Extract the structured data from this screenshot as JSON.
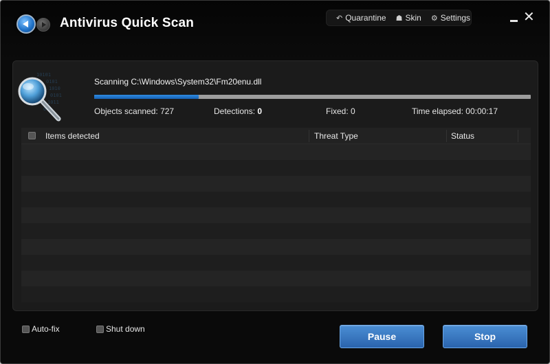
{
  "window": {
    "title": "Antivirus Quick Scan"
  },
  "toolbar": {
    "quarantine": {
      "label": "Quarantine",
      "icon": "undo-arrow-icon"
    },
    "skin": {
      "label": "Skin",
      "icon": "shirt-icon"
    },
    "settings": {
      "label": "Settings",
      "icon": "gear-icon"
    }
  },
  "scan": {
    "current_file": "Scanning C:\\Windows\\System32\\Fm20enu.dll",
    "progress_percent": 24,
    "objects_scanned_label": "Objects scanned:",
    "objects_scanned_value": "727",
    "detections_label": "Detections:",
    "detections_value": "0",
    "fixed_label": "Fixed:",
    "fixed_value": "0",
    "time_label": "Time elapsed:",
    "time_value": "00:00:17"
  },
  "table": {
    "columns": [
      "Items detected",
      "Threat Type",
      "Status"
    ],
    "rows": []
  },
  "footer": {
    "autofix_label": "Auto-fix",
    "shutdown_label": "Shut down",
    "pause_label": "Pause",
    "stop_label": "Stop"
  },
  "colors": {
    "accent": "#2f8be0",
    "button": "#3a79c2",
    "background": "#0a0a0a"
  }
}
